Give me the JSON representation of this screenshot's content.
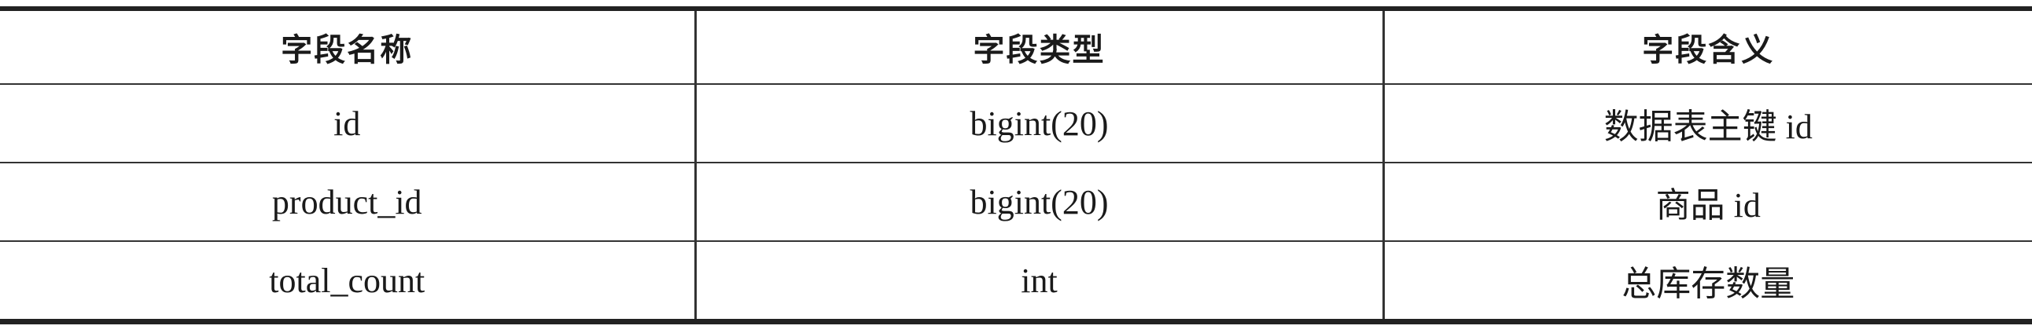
{
  "table": {
    "headers": [
      "字段名称",
      "字段类型",
      "字段含义"
    ],
    "rows": [
      [
        "id",
        "bigint(20)",
        "数据表主键 id"
      ],
      [
        "product_id",
        "bigint(20)",
        "商品 id"
      ],
      [
        "total_count",
        "int",
        "总库存数量"
      ]
    ]
  }
}
